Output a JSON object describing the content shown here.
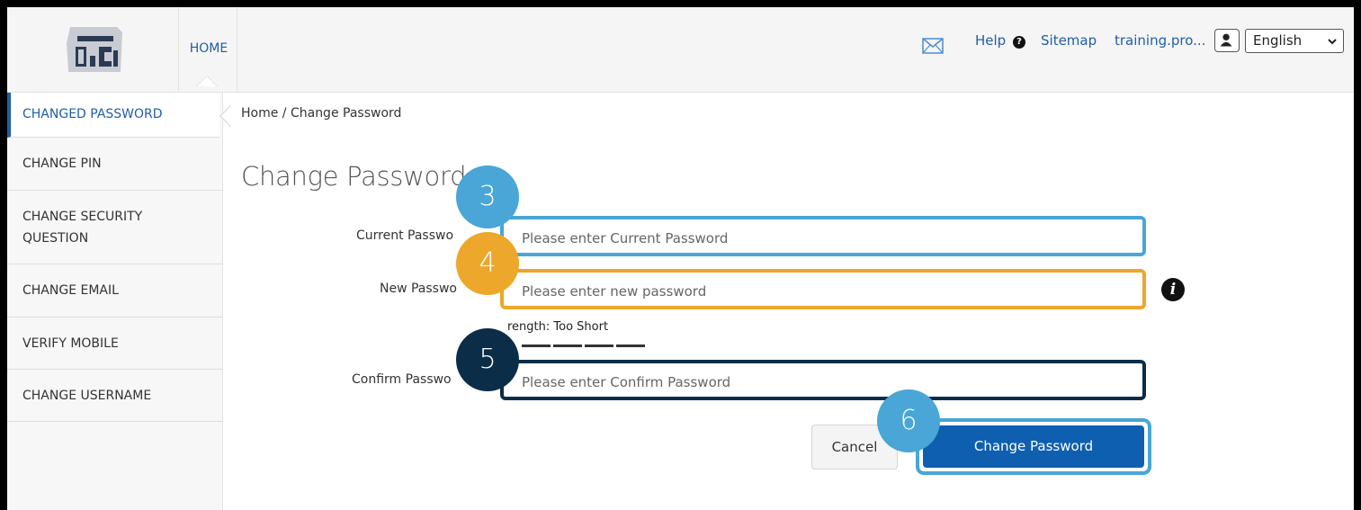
{
  "header": {
    "home_label": "HOME",
    "help_label": "Help",
    "help_icon_glyph": "?",
    "sitemap_label": "Sitemap",
    "user_label": "training.pro...",
    "language_selected": "English",
    "icons": [
      "logo-icon",
      "mail-icon",
      "question-icon",
      "user-icon",
      "chevron-down-icon"
    ]
  },
  "sidebar": {
    "items": [
      {
        "label": "CHANGED PASSWORD",
        "active": true
      },
      {
        "label": "CHANGE PIN",
        "active": false
      },
      {
        "label": "CHANGE SECURITY\nQUESTION",
        "active": false
      },
      {
        "label": "CHANGE EMAIL",
        "active": false
      },
      {
        "label": "VERIFY MOBILE",
        "active": false
      },
      {
        "label": "CHANGE USERNAME",
        "active": false
      }
    ]
  },
  "main": {
    "breadcrumb": "Home / Change Password",
    "title": "Change Password",
    "form": {
      "current_label": "Current Passwo",
      "current_placeholder": "Please enter Current Password",
      "new_label": "New Passwo",
      "new_placeholder": "Please enter new password",
      "strength_text": "rength: Too Short",
      "strength_level_segments": 4,
      "confirm_label": "Confirm Passwo",
      "confirm_placeholder": "Please enter Confirm Password",
      "info_glyph": "i"
    },
    "buttons": {
      "cancel_label": "Cancel",
      "change_label": "Change Password"
    }
  },
  "callouts": {
    "step_3": "3",
    "step_4": "4",
    "step_5": "5",
    "step_6": "6"
  },
  "colors": {
    "accent_blue": "#1f5ea8",
    "callout_light_blue": "#49a6d6",
    "callout_orange": "#eda72a",
    "callout_navy": "#0c2d48",
    "primary_button": "#0f5fb0"
  }
}
